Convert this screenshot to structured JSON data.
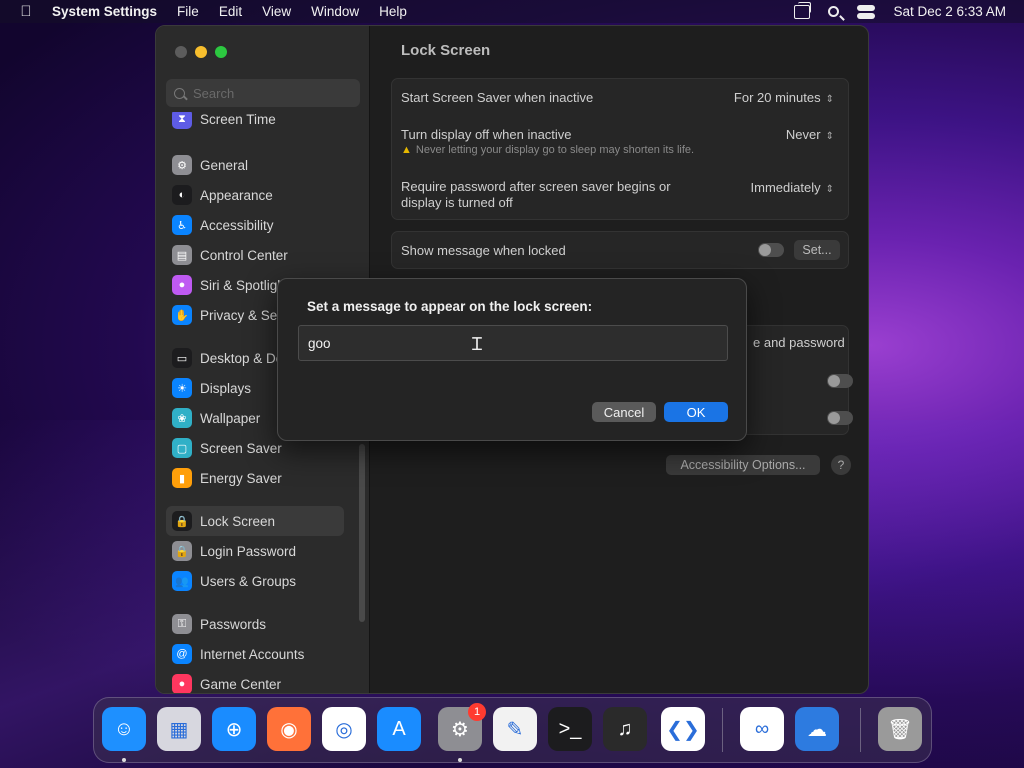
{
  "menubar": {
    "app_name": "System Settings",
    "menus": [
      "File",
      "Edit",
      "View",
      "Window",
      "Help"
    ],
    "clock": "Sat Dec 2  6:33 AM"
  },
  "sidebar": {
    "search_placeholder": "Search",
    "items": [
      {
        "label": "Screen Time",
        "icon": "hourglass-icon",
        "color": "#5e5ce6"
      },
      {
        "label": "General",
        "icon": "gear-icon",
        "color": "#8e8e93"
      },
      {
        "label": "Appearance",
        "icon": "appearance-icon",
        "color": "#1c1c1e"
      },
      {
        "label": "Accessibility",
        "icon": "accessibility-icon",
        "color": "#0a84ff"
      },
      {
        "label": "Control Center",
        "icon": "control-center-icon",
        "color": "#8e8e93"
      },
      {
        "label": "Siri & Spotlight",
        "icon": "siri-icon",
        "color": "#bf5af2"
      },
      {
        "label": "Privacy & Security",
        "icon": "hand-icon",
        "color": "#0a84ff"
      },
      {
        "label": "Desktop & Dock",
        "icon": "desktop-icon",
        "color": "#1c1c1e"
      },
      {
        "label": "Displays",
        "icon": "sun-icon",
        "color": "#0a84ff"
      },
      {
        "label": "Wallpaper",
        "icon": "wallpaper-icon",
        "color": "#30b0c7"
      },
      {
        "label": "Screen Saver",
        "icon": "screen-saver-icon",
        "color": "#30b0c7"
      },
      {
        "label": "Energy Saver",
        "icon": "battery-icon",
        "color": "#ff9f0a"
      },
      {
        "label": "Lock Screen",
        "icon": "lock-icon",
        "color": "#1c1c1e"
      },
      {
        "label": "Login Password",
        "icon": "lock-icon",
        "color": "#8e8e93"
      },
      {
        "label": "Users & Groups",
        "icon": "users-icon",
        "color": "#0a84ff"
      },
      {
        "label": "Passwords",
        "icon": "key-icon",
        "color": "#8e8e93"
      },
      {
        "label": "Internet Accounts",
        "icon": "at-icon",
        "color": "#0a84ff"
      },
      {
        "label": "Game Center",
        "icon": "game-center-icon",
        "color": "#ff375f"
      }
    ],
    "selected": "Lock Screen"
  },
  "content": {
    "title": "Lock Screen",
    "screen_saver_label": "Start Screen Saver when inactive",
    "screen_saver_value": "For 20 minutes",
    "display_off_label": "Turn display off when inactive",
    "display_off_value": "Never",
    "display_off_warning": "Never letting your display go to sleep may shorten its life.",
    "require_password_label_1": "Require password after screen saver begins or",
    "require_password_label_2": "display is turned off",
    "require_password_value": "Immediately",
    "show_message_label": "Show message when locked",
    "set_button": "Set...",
    "partial_label": "e and password",
    "accessibility_button": "Accessibility Options...",
    "help_button": "?"
  },
  "dialog": {
    "title": "Set a message to appear on the lock screen:",
    "input_value": "goo",
    "cancel_label": "Cancel",
    "ok_label": "OK"
  },
  "dock": {
    "apps": [
      {
        "name": "Finder",
        "icon": "finder-icon",
        "color": "#1e90ff",
        "running": true
      },
      {
        "name": "Launchpad",
        "icon": "launchpad-icon",
        "color": "#d7d7df",
        "running": false
      },
      {
        "name": "Safari",
        "icon": "safari-icon",
        "color": "#1a8cff",
        "running": false
      },
      {
        "name": "Firefox",
        "icon": "firefox-icon",
        "color": "#ff7139",
        "running": false
      },
      {
        "name": "Chrome",
        "icon": "chrome-icon",
        "color": "#ffffff",
        "running": false
      },
      {
        "name": "App Store",
        "icon": "app-store-icon",
        "color": "#1a8cff",
        "running": false
      },
      {
        "name": "System Settings",
        "icon": "gear-icon",
        "color": "#8e8e93",
        "running": true,
        "badge": "1"
      },
      {
        "name": "TextEdit",
        "icon": "textedit-icon",
        "color": "#f2f2f2",
        "running": false
      },
      {
        "name": "Terminal",
        "icon": "terminal-icon",
        "color": "#1c1c1e",
        "running": false
      },
      {
        "name": "GarageBand",
        "icon": "guitar-icon",
        "color": "#2a2a2a",
        "running": false
      },
      {
        "name": "Visual Studio Code",
        "icon": "vscode-icon",
        "color": "#ffffff",
        "running": false
      },
      {
        "name": "Visual Studio",
        "icon": "visual-studio-icon",
        "color": "#ffffff",
        "running": false
      },
      {
        "name": "Weather",
        "icon": "weather-icon",
        "color": "#2d7be0",
        "running": false
      },
      {
        "name": "Trash",
        "icon": "trash-icon",
        "color": "#9a9a9a",
        "running": false
      }
    ]
  }
}
